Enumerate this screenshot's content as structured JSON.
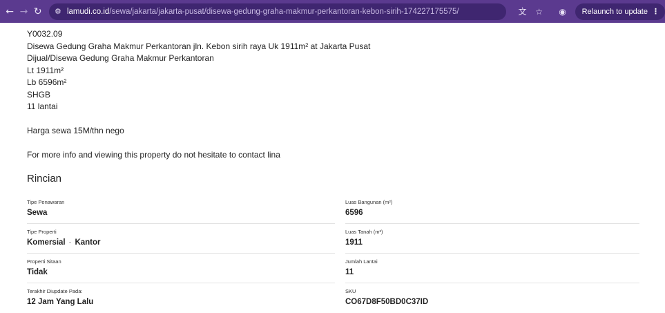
{
  "browser": {
    "url_host": "lamudi.co.id",
    "url_path": "/sewa/jakarta/jakarta-pusat/disewa-gedung-graha-makmur-perkantoran-kebon-sirih-174227175575/",
    "relaunch_label": "Relaunch to update",
    "icons": [
      "back-arrow-icon",
      "forward-arrow-icon",
      "reload-icon",
      "site-settings-icon",
      "translate-icon",
      "star-icon",
      "profile-icon",
      "more-vert-icon"
    ]
  },
  "description": {
    "lines": [
      "Y0032.09",
      "Disewa Gedung Graha Makmur Perkantoran jln. Kebon sirih raya Uk 1911m² at Jakarta Pusat",
      "Dijual/Disewa Gedung Graha Makmur Perkantoran",
      "Lt 1911m²",
      "Lb 6596m²",
      "SHGB",
      "11 lantai"
    ],
    "price_line": "Harga sewa 15M/thn nego",
    "contact_line": "For more info and viewing this property do not hesitate to contact lina"
  },
  "details": {
    "title": "Rincian",
    "left": [
      {
        "label": "Tipe Penawaran",
        "value": "Sewa"
      },
      {
        "label": "Tipe Properti",
        "value": "Komersial",
        "value2": "Kantor",
        "separator": "-"
      },
      {
        "label": "Properti Sitaan",
        "value": "Tidak"
      },
      {
        "label": "Terakhir Diupdate Pada:",
        "value": "12 Jam Yang Lalu"
      }
    ],
    "right": [
      {
        "label": "Luas Bangunan (m²)",
        "value": "6596"
      },
      {
        "label": "Luas Tanah (m²)",
        "value": "1911"
      },
      {
        "label": "Jumlah Lantai",
        "value": "11"
      },
      {
        "label": "SKU",
        "value": "CO67D8F50BD0C37ID"
      }
    ]
  }
}
